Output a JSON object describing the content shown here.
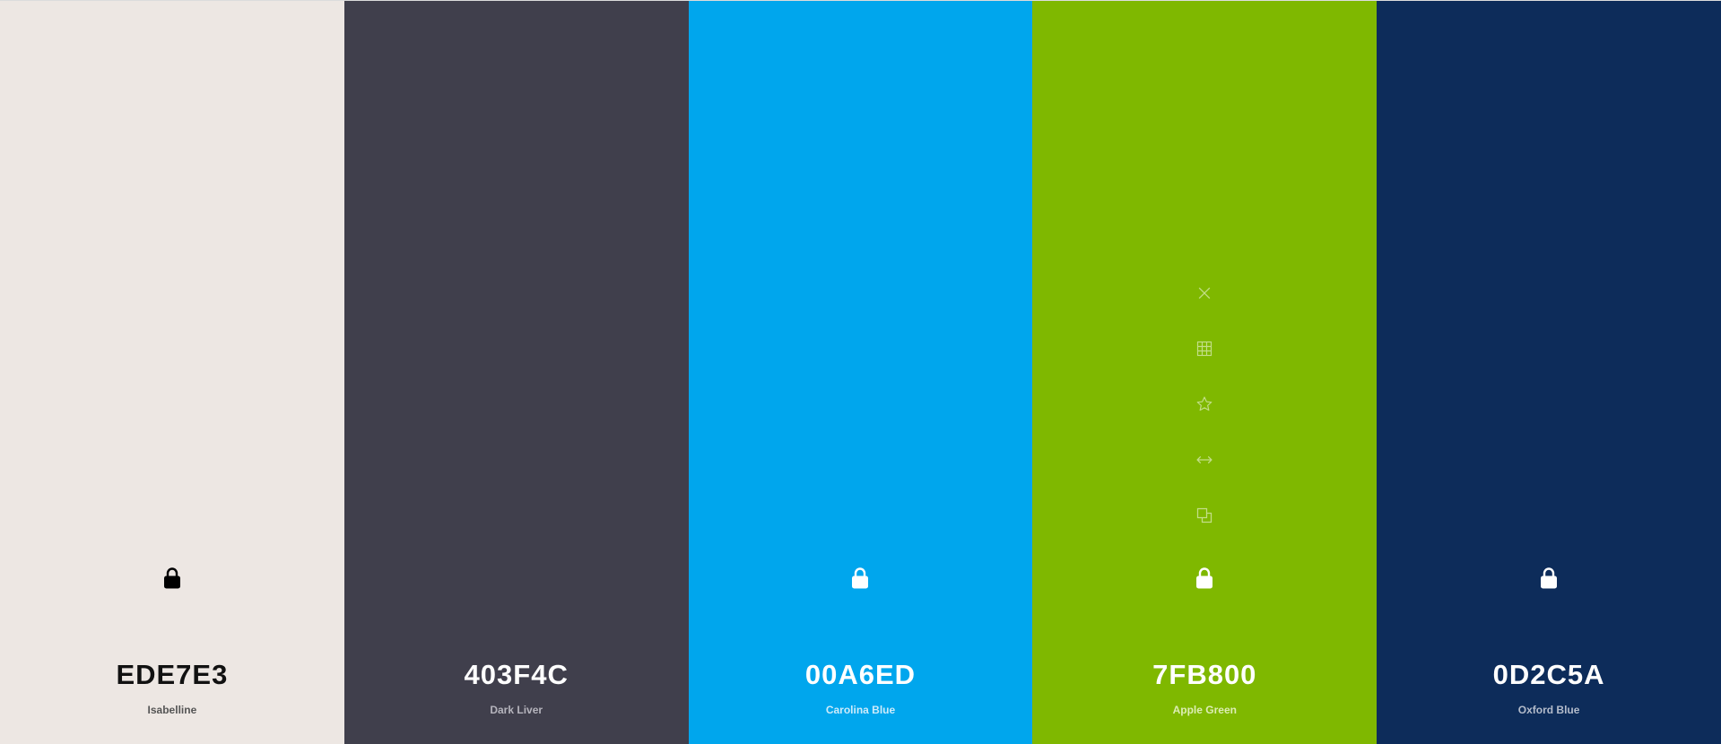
{
  "swatches": [
    {
      "hex": "EDE7E3",
      "name": "Isabelline",
      "bg": "#EDE7E3",
      "text_color": "#111111",
      "name_color": "#555555",
      "lock": true,
      "lock_color": "#000000",
      "tools": false
    },
    {
      "hex": "403F4C",
      "name": "Dark Liver",
      "bg": "#403F4C",
      "text_color": "#FFFFFF",
      "name_color": "#B5B4BC",
      "lock": false,
      "lock_color": "#FFFFFF",
      "tools": false
    },
    {
      "hex": "00A6ED",
      "name": "Carolina Blue",
      "bg": "#00A6ED",
      "text_color": "#FFFFFF",
      "name_color": "#CDEBFA",
      "lock": true,
      "lock_color": "#FFFFFF",
      "tools": false
    },
    {
      "hex": "7FB800",
      "name": "Apple Green",
      "bg": "#7FB800",
      "text_color": "#FFFFFF",
      "name_color": "#DDEDB5",
      "lock": true,
      "lock_color": "#FFFFFF",
      "tools": true
    },
    {
      "hex": "0D2C5A",
      "name": "Oxford Blue",
      "bg": "#0D2C5A",
      "text_color": "#FFFFFF",
      "name_color": "#B4BCCB",
      "lock": true,
      "lock_color": "#FFFFFF",
      "tools": false
    }
  ],
  "tool_icons": [
    "close-icon",
    "grid-icon",
    "star-icon",
    "drag-arrows-icon",
    "copy-icon"
  ],
  "tool_color": "#C3DE88"
}
